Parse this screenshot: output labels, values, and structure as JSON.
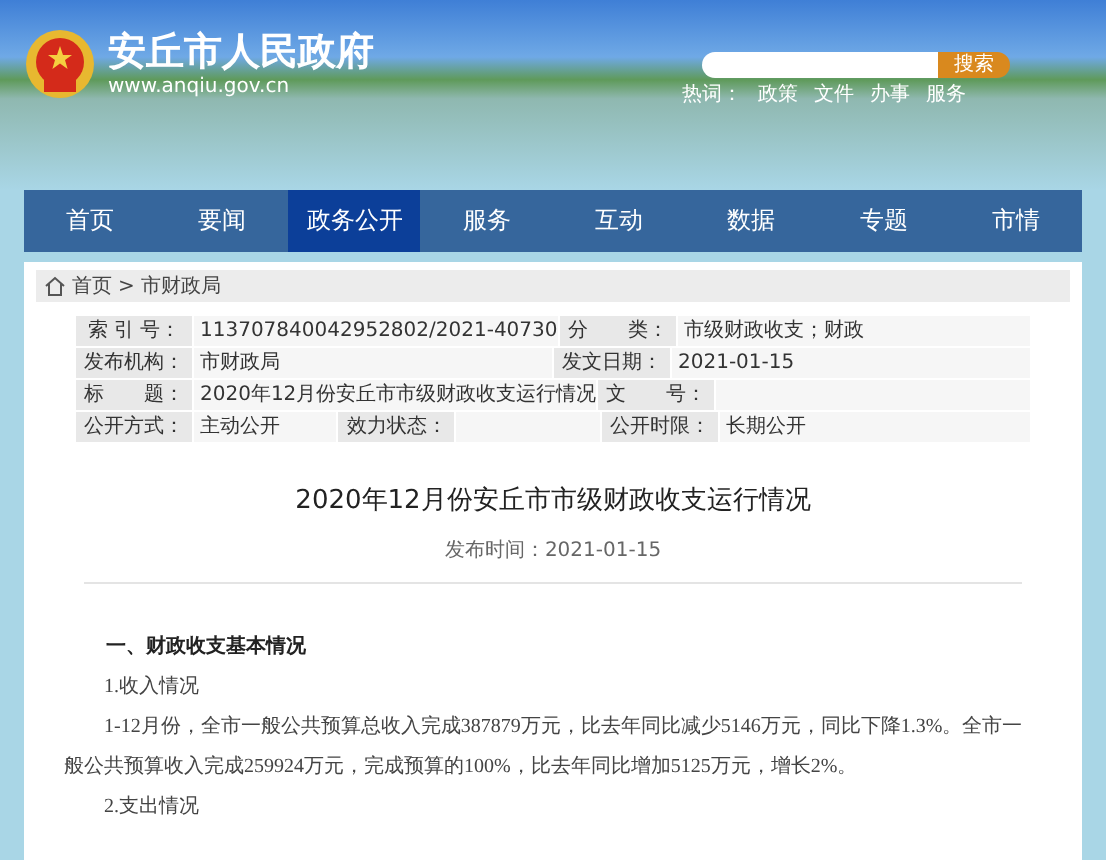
{
  "header": {
    "site_name": "安丘市人民政府",
    "site_url": "www.anqiu.gov.cn",
    "search": {
      "button": "搜索"
    },
    "hot_words_label": "热词：",
    "hot_words": [
      "政策",
      "文件",
      "办事",
      "服务"
    ]
  },
  "nav": [
    {
      "label": "首页",
      "selected": false
    },
    {
      "label": "要闻",
      "selected": false
    },
    {
      "label": "政务公开",
      "selected": true
    },
    {
      "label": "服务",
      "selected": false
    },
    {
      "label": "互动",
      "selected": false
    },
    {
      "label": "数据",
      "selected": false
    },
    {
      "label": "专题",
      "selected": false
    },
    {
      "label": "市情",
      "selected": false
    }
  ],
  "breadcrumb": [
    "首页",
    "市财政局"
  ],
  "breadcrumb_separator": ">",
  "meta_rows": [
    [
      {
        "kind": "label",
        "text": "索 引 号："
      },
      {
        "kind": "value",
        "text": "113707840042952802/2021-40730"
      },
      {
        "kind": "label",
        "text": "分　　类："
      },
      {
        "kind": "value",
        "text": "市级财政收支；财政"
      }
    ],
    [
      {
        "kind": "label",
        "text": "发布机构："
      },
      {
        "kind": "value",
        "text": "市财政局"
      },
      {
        "kind": "label",
        "text": "发文日期："
      },
      {
        "kind": "value",
        "text": "2021-01-15"
      }
    ],
    [
      {
        "kind": "label",
        "text": "标　　题："
      },
      {
        "kind": "value",
        "text": "2020年12月份安丘市市级财政收支运行情况"
      },
      {
        "kind": "label",
        "text": "文　　号："
      },
      {
        "kind": "value"
      }
    ],
    [
      {
        "kind": "label",
        "text": "公开方式："
      },
      {
        "kind": "half",
        "text": "主动公开"
      },
      {
        "kind": "label",
        "text": "效力状态："
      },
      {
        "kind": "half"
      },
      {
        "kind": "label",
        "text": "公开时限："
      },
      {
        "kind": "value",
        "text": "长期公开"
      }
    ]
  ],
  "article": {
    "title": "2020年12月份安丘市市级财政收支运行情况",
    "publish_time": "发布时间：2021-01-15",
    "blocks": [
      {
        "kind": "heading",
        "text": "一、财政收支基本情况"
      },
      {
        "kind": "subheading",
        "text": "1.收入情况"
      },
      {
        "kind": "paragraph",
        "text": "1-12月份，全市一般公共预算总收入完成387879万元，比去年同比减少5146万元，同比下降1.3%。全市一般公共预算收入完成259924万元，完成预算的100%，比去年同比增加5125万元，增长2%。"
      },
      {
        "kind": "subheading",
        "text": "2.支出情况"
      }
    ]
  }
}
